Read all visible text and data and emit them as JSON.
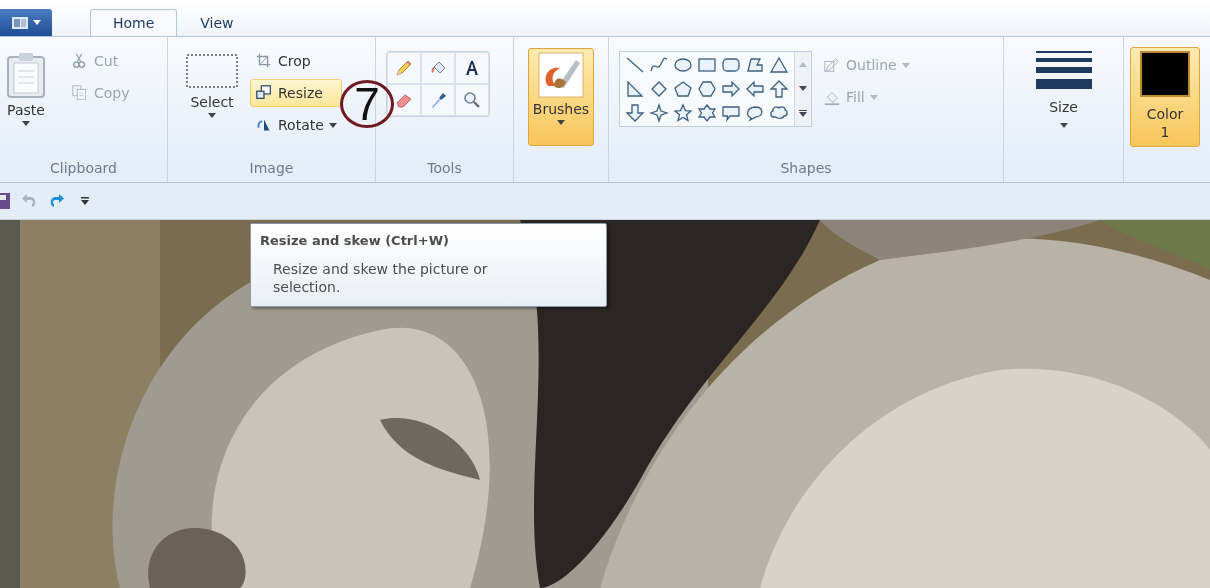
{
  "tabs": [
    {
      "label": "Home",
      "selected": true
    },
    {
      "label": "View",
      "selected": false
    }
  ],
  "ribbon": {
    "clipboard": {
      "label": "Clipboard",
      "paste": "Paste",
      "items": [
        {
          "kind": "cut",
          "label": "Cut",
          "disabled": true
        },
        {
          "kind": "copy",
          "label": "Copy",
          "disabled": true
        }
      ]
    },
    "image": {
      "label": "Image",
      "select": "Select",
      "items": [
        {
          "kind": "crop",
          "label": "Crop",
          "hovered": false,
          "dropdown": false
        },
        {
          "kind": "resize",
          "label": "Resize",
          "hovered": true,
          "dropdown": false
        },
        {
          "kind": "rotate",
          "label": "Rotate",
          "hovered": false,
          "dropdown": true
        }
      ]
    },
    "tools": {
      "label": "Tools",
      "items": [
        {
          "kind": "pencil"
        },
        {
          "kind": "fill"
        },
        {
          "kind": "text"
        },
        {
          "kind": "eraser"
        },
        {
          "kind": "picker"
        },
        {
          "kind": "magnifier"
        }
      ]
    },
    "brushes": {
      "label": "Brushes",
      "active": true
    },
    "shapes": {
      "label": "Shapes",
      "gallery": [
        {
          "kind": "line"
        },
        {
          "kind": "curve"
        },
        {
          "kind": "oval"
        },
        {
          "kind": "rectangle"
        },
        {
          "kind": "rounded"
        },
        {
          "kind": "polygon"
        },
        {
          "kind": "triangle"
        },
        {
          "kind": "right-triangle"
        },
        {
          "kind": "diamond"
        },
        {
          "kind": "pentagon"
        },
        {
          "kind": "hexagon"
        },
        {
          "kind": "right-arrow"
        },
        {
          "kind": "left-arrow"
        },
        {
          "kind": "up-arrow"
        },
        {
          "kind": "down-arrow"
        },
        {
          "kind": "star4"
        },
        {
          "kind": "star5"
        },
        {
          "kind": "star6"
        },
        {
          "kind": "rect-callout"
        },
        {
          "kind": "oval-callout"
        },
        {
          "kind": "cloud-callout"
        }
      ],
      "outline": {
        "label": "Outline",
        "disabled": true
      },
      "fill": {
        "label": "Fill",
        "disabled": true
      }
    },
    "size": {
      "label": "Size"
    },
    "color1": {
      "label": "Color",
      "sub": "1",
      "selected": true,
      "color": "#000000"
    }
  },
  "annotation": "7",
  "tooltip": {
    "title": "Resize and skew (Ctrl+W)",
    "body": "Resize and skew the picture or selection."
  }
}
